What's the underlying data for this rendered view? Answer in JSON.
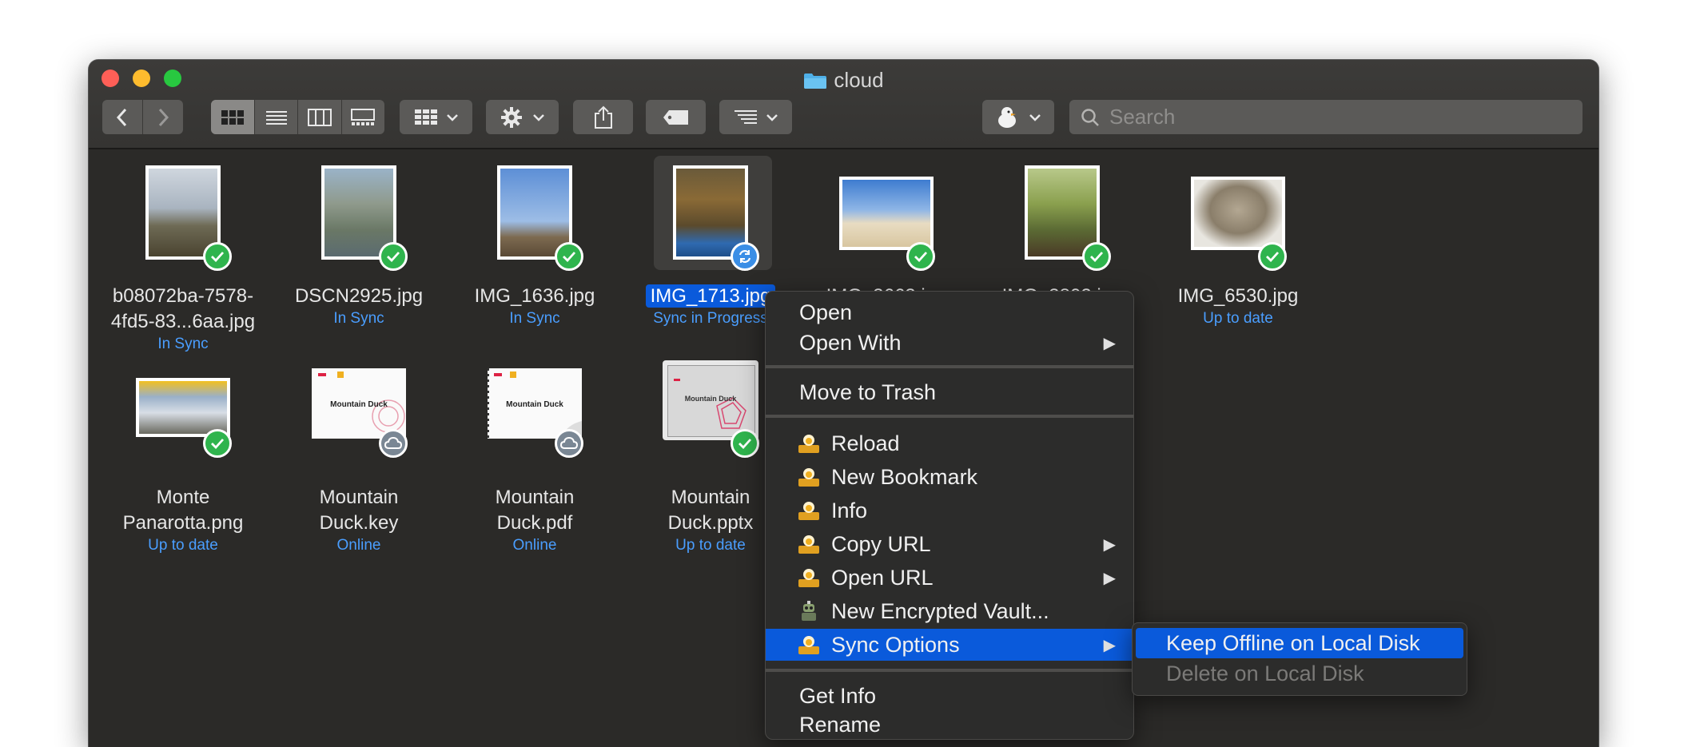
{
  "window": {
    "title": "cloud"
  },
  "toolbar": {
    "search_placeholder": "Search"
  },
  "files": [
    {
      "name": "b08072ba-7578-4fd5-83...6aa.jpg",
      "status": "In Sync"
    },
    {
      "name": "DSCN2925.jpg",
      "status": "In Sync"
    },
    {
      "name": "IMG_1636.jpg",
      "status": "In Sync"
    },
    {
      "name": "IMG_1713.jpg",
      "status": "Sync in Progress"
    },
    {
      "name": "IMG_3663.jpg",
      "status": ""
    },
    {
      "name": "IMG_3802.jpg",
      "status": ""
    },
    {
      "name": "IMG_6530.jpg",
      "status": "Up to date"
    },
    {
      "name": "Monte Panarotta.png",
      "status": "Up to date"
    },
    {
      "name": "Mountain Duck.key",
      "status": "Online"
    },
    {
      "name": "Mountain Duck.pdf",
      "status": "Online"
    },
    {
      "name": "Mountain Duck.pptx",
      "status": "Up to date"
    }
  ],
  "thumb_text": {
    "doc_title": "Mountain Duck"
  },
  "context_menu": {
    "items": [
      "Open",
      "Open With",
      "Move to Trash",
      "Reload",
      "New Bookmark",
      "Info",
      "Copy URL",
      "Open URL",
      "New Encrypted Vault...",
      "Sync Options",
      "Get Info",
      "Rename"
    ]
  },
  "submenu": {
    "items": [
      "Keep Offline on Local Disk",
      "Delete on Local Disk"
    ]
  },
  "colors": {
    "accent": "#0a5adb",
    "status_text": "#4a9eff",
    "badge_ok": "#2fb44d"
  }
}
